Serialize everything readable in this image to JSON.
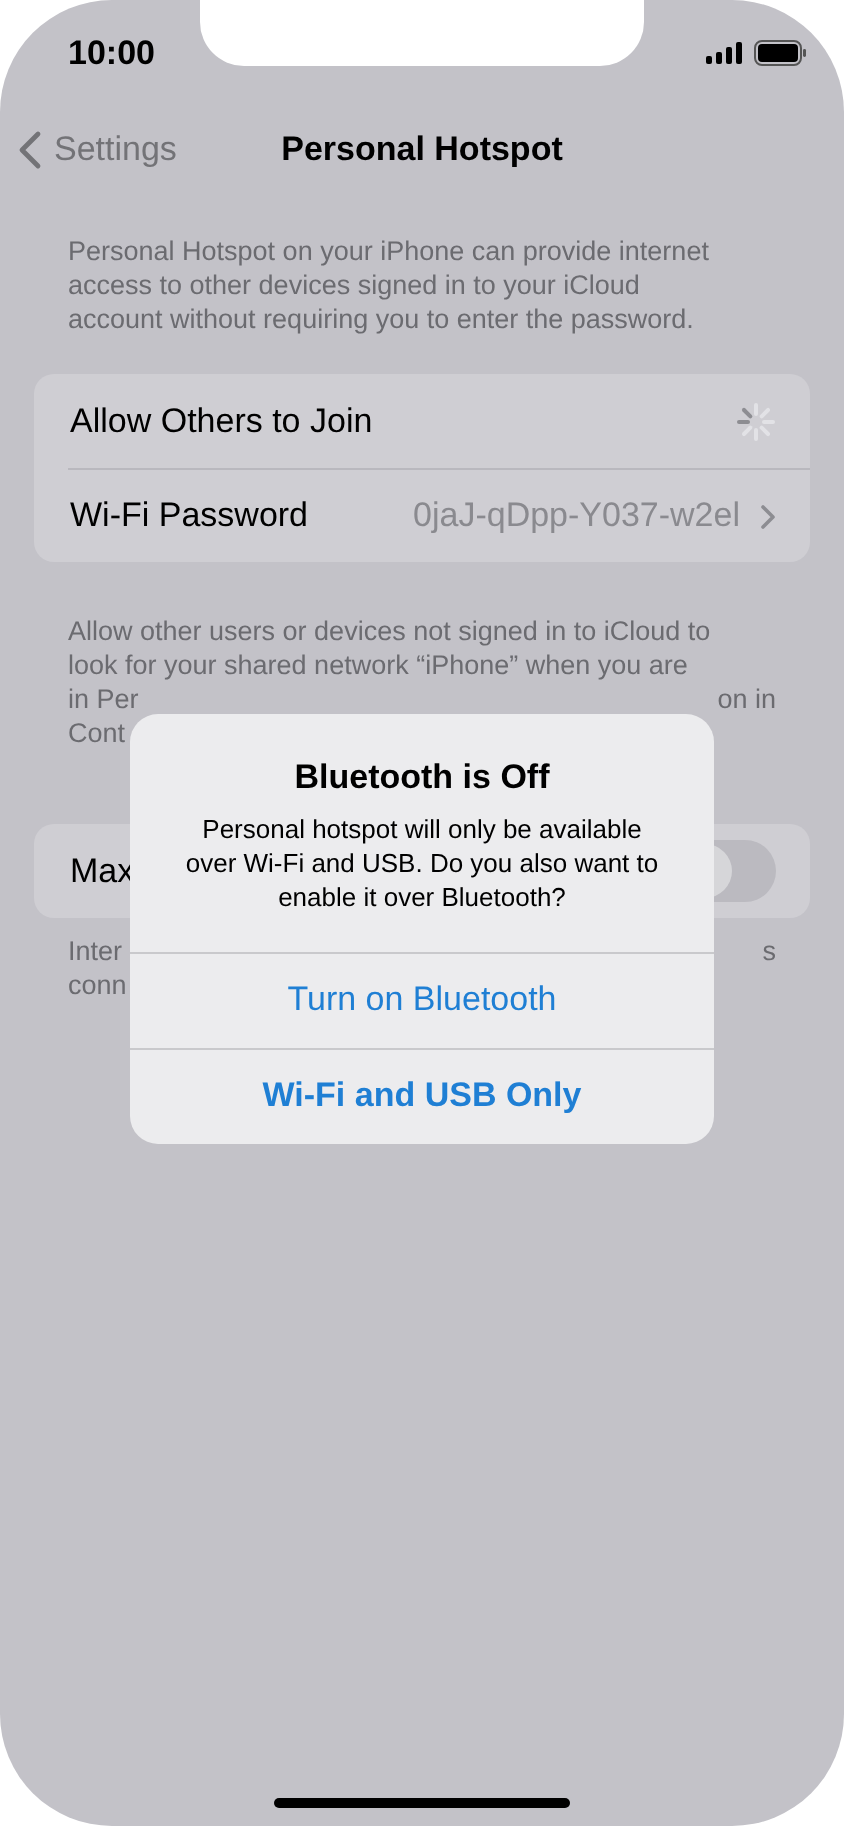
{
  "status_bar": {
    "time": "10:00"
  },
  "nav": {
    "back": "Settings",
    "title": "Personal Hotspot"
  },
  "intro": [
    "Personal Hotspot on your iPhone can provide internet",
    "access to other devices signed in to your iCloud",
    "account without requiring you to enter the password."
  ],
  "settings": [
    {
      "kind": "spinner",
      "label": "Allow Others to Join"
    },
    {
      "kind": "value",
      "label": "Wi-Fi Password",
      "value": "0jaJ-qDpp-Y037-w2el"
    }
  ],
  "family_note": [
    {
      "left": "Allow other users or devices not signed in to iCloud to"
    },
    {
      "left": "look for your shared network “iPhone” when you are"
    },
    {
      "left": "in Per",
      "right": "on in"
    },
    {
      "left": "Cont"
    }
  ],
  "max_row": {
    "label": "Max",
    "on": false
  },
  "footer_note": [
    {
      "left": "Inter",
      "right": "s"
    },
    {
      "left": "conn"
    }
  ],
  "alert": {
    "title": "Bluetooth is Off",
    "message": "Personal hotspot will only be available over Wi-Fi and USB. Do you also want to enable it over Bluetooth?",
    "buttons": [
      {
        "label": "Turn on Bluetooth",
        "kind": "default"
      },
      {
        "label": "Wi-Fi and USB Only",
        "kind": "preferred"
      }
    ]
  }
}
